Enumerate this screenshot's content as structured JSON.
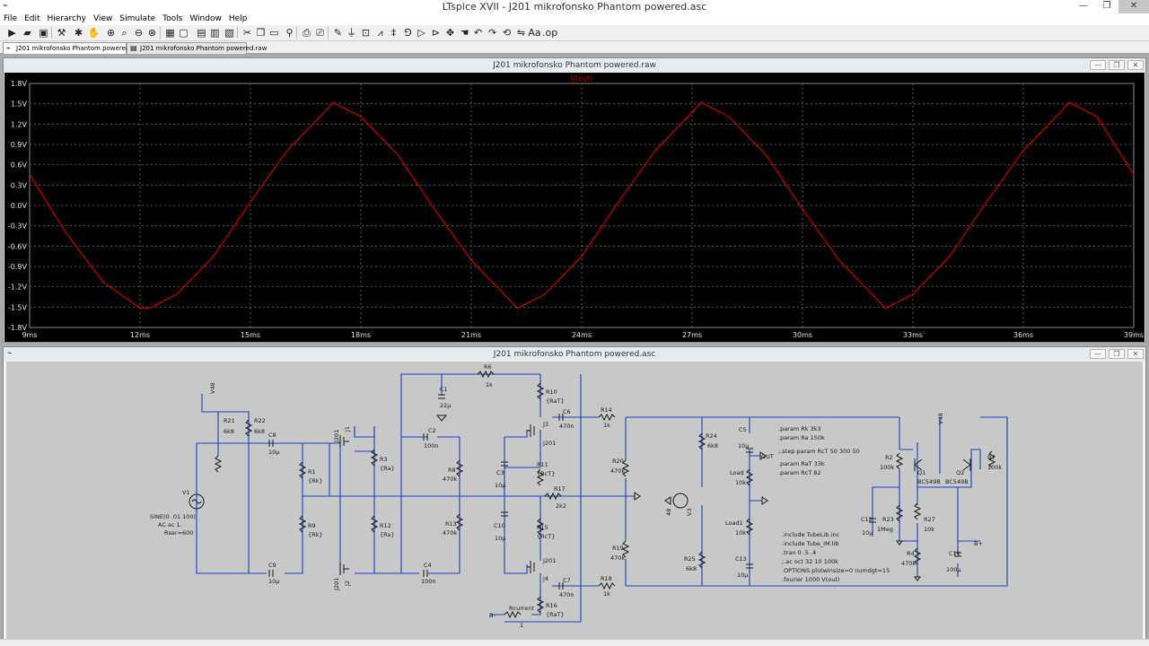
{
  "app": {
    "title": "LTspice XVII - J201 mikrofonsko Phantom powered.asc",
    "window_controls": [
      "—",
      "❐",
      "✕"
    ]
  },
  "menu": [
    "File",
    "Edit",
    "Hierarchy",
    "View",
    "Simulate",
    "Tools",
    "Window",
    "Help"
  ],
  "toolbar_icons": [
    "run-icon",
    "open-icon",
    "save-icon",
    "control-panel-icon",
    "run-man-icon",
    "hand-icon",
    "zoom-in-icon",
    "zoom-icon",
    "zoom-out-icon",
    "zoom-fit-icon",
    "autorange-icon",
    "tile-icon",
    "cascade-icon",
    "close-all-icon",
    "cut-icon",
    "copy-icon",
    "paste-icon",
    "find-icon",
    "print-icon",
    "print-setup-icon",
    "pencil-icon",
    "ground-icon",
    "label-icon",
    "resistor-icon",
    "capacitor-icon",
    "inductor-icon",
    "diode-icon",
    "component-icon",
    "move-icon",
    "drag-icon",
    "undo-icon",
    "redo-icon",
    "rotate-icon",
    "mirror-icon",
    "text-icon",
    "spice-directive-icon"
  ],
  "tabs": [
    {
      "label": "J201 mikrofonsko Phantom powered.asc",
      "active": true
    },
    {
      "label": "J201 mikrofonsko Phantom powered.raw",
      "active": false
    }
  ],
  "plot_window": {
    "title": "J201 mikrofonsko Phantom powered.raw",
    "trace_label": "V(out)",
    "trace_color": "#d40000",
    "background": "#000000",
    "grid_color": "#5a5a5a",
    "text_color": "#e0e0e0"
  },
  "chart_data": {
    "type": "line",
    "title": "",
    "xlabel": "",
    "ylabel": "",
    "xlim_ms": [
      9,
      39
    ],
    "ylim_V": [
      -1.8,
      1.8
    ],
    "x_ticks": [
      "9ms",
      "12ms",
      "15ms",
      "18ms",
      "21ms",
      "24ms",
      "27ms",
      "30ms",
      "33ms",
      "36ms",
      "39ms"
    ],
    "y_ticks": [
      "1.8V",
      "1.5V",
      "1.2V",
      "0.9V",
      "0.6V",
      "0.3V",
      "0.0V",
      "-0.3V",
      "-0.6V",
      "-0.9V",
      "-1.2V",
      "-1.5V",
      "-1.8V"
    ],
    "series": [
      {
        "name": "V(out)",
        "x_ms": [
          9.0,
          10.0,
          11.0,
          12.0,
          12.25,
          13.0,
          14.0,
          15.0,
          16.0,
          17.0,
          17.25,
          18.0,
          19.0,
          20.0,
          21.0,
          22.0,
          22.25,
          23.0,
          24.0,
          25.0,
          26.0,
          27.0,
          27.25,
          28.0,
          29.0,
          30.0,
          31.0,
          32.0,
          32.25,
          33.0,
          34.0,
          35.0,
          36.0,
          37.0,
          37.25,
          38.0,
          39.0
        ],
        "y_V": [
          0.46,
          -0.41,
          -1.13,
          -1.51,
          -1.52,
          -1.31,
          -0.75,
          0.05,
          0.81,
          1.37,
          1.52,
          1.31,
          0.75,
          -0.05,
          -0.81,
          -1.37,
          -1.52,
          -1.31,
          -0.75,
          0.05,
          0.81,
          1.37,
          1.52,
          1.31,
          0.75,
          -0.05,
          -0.81,
          -1.37,
          -1.52,
          -1.31,
          -0.75,
          0.05,
          0.81,
          1.37,
          1.52,
          1.31,
          0.46
        ]
      }
    ]
  },
  "schematic_window": {
    "title": "J201 mikrofonsko Phantom powered.asc",
    "background": "#c8c8c8",
    "wire_color": "#1c3fc2",
    "part_color": "#1a1a1a",
    "labels": {
      "V48_top": "V48",
      "R21": "R21",
      "R21v": "6k8",
      "R22": "R22",
      "R22v": "6k8",
      "C8": "C8",
      "C8v": "10µ",
      "C9": "C9",
      "C9v": "10µ",
      "V1": "V1",
      "V1spec1": "SINE(0 .01 100)",
      "V1spec2": "AC ac 1.",
      "V1spec3": "Rser=600",
      "R1": "R1",
      "R1v": "{Rk}",
      "R9": "R9",
      "R9v": "{Rk}",
      "J1": "J1",
      "J1m": "J201",
      "J2": "J2",
      "J2m": "J201",
      "R3": "R3",
      "R3v": "{Ra}",
      "R12": "R12",
      "R12v": "{Ra}",
      "C1": "C1",
      "C1v": "22µ",
      "C2": "C2",
      "C2v": "100n",
      "C4": "C4",
      "C4v": "100n",
      "R6": "R6",
      "R6v": "1k",
      "R8": "R8",
      "R8v": "470k",
      "R13": "R13",
      "R13v": "470k",
      "C3": "C3",
      "C3v": "10µ",
      "C10": "C10",
      "C10v": "10µ",
      "R10": "R10",
      "R10v": "{RaT}",
      "R11": "R11",
      "R11v": "{RcT}",
      "R15": "R15",
      "R15v": "{RcT}",
      "R16": "R16",
      "R16v": "{RaT}",
      "J3": "J3",
      "J3m": "J201",
      "J4": "J4",
      "J4m": "J201",
      "C6": "C6",
      "C6v": "470n",
      "C7": "C7",
      "C7v": "470n",
      "R17": "R17",
      "R17v": "2k2",
      "R14": "R14",
      "R14v": "1k",
      "R18": "R18",
      "R18v": "1k",
      "R20": "R20",
      "R20v": "470k",
      "R19": "R19",
      "R19v": "470k",
      "Rcur": "Rcurrent",
      "Rcurv": "1",
      "Bminus": "B-",
      "V3": "V3",
      "V3v": "48",
      "R24": "R24",
      "R24v": "6k8",
      "R25": "R25",
      "R25v": "6k8",
      "C5": "C5",
      "C5v": "10µ",
      "C13": "C13",
      "C13v": "10µ",
      "OUT": "OUT",
      "Load": "Load",
      "Loadv": "10k",
      "Load1": "Load1",
      "Load1v": "10k",
      "param1": ".param Rk 3k3",
      "param2": ".param Ra 150k",
      "param3": ";.step param RcT 50 300 50",
      "param4": ".param RaT 33k",
      "param5": ".param RcT 82",
      "inc1": ".include TubeLib.inc",
      "inc2": ".include Tube_IM.lib",
      "tran": ".tran 0 .5 .4",
      "ac": ";.ac oct 32 10 100k",
      "opts": ".OPTIONS plotwinsize=0 numdgt=15",
      "fourier": ".fourier 1000 V(out)",
      "V48_right": "V48",
      "R2": "R2",
      "R2v": "100k",
      "Q1": "Q1",
      "Q1m": "BC549B",
      "Q2": "Q2",
      "Q2m": "BC549B",
      "R7": "R7",
      "R7v": "100k",
      "C12": "C12",
      "C12v": "10µ",
      "R23": "R23",
      "R23v": "1Meg",
      "R27": "R27",
      "R27v": "10k",
      "R4": "R4",
      "R4v": "470k",
      "C11": "C11",
      "C11v": "100µ",
      "Bplus": "B+"
    }
  }
}
